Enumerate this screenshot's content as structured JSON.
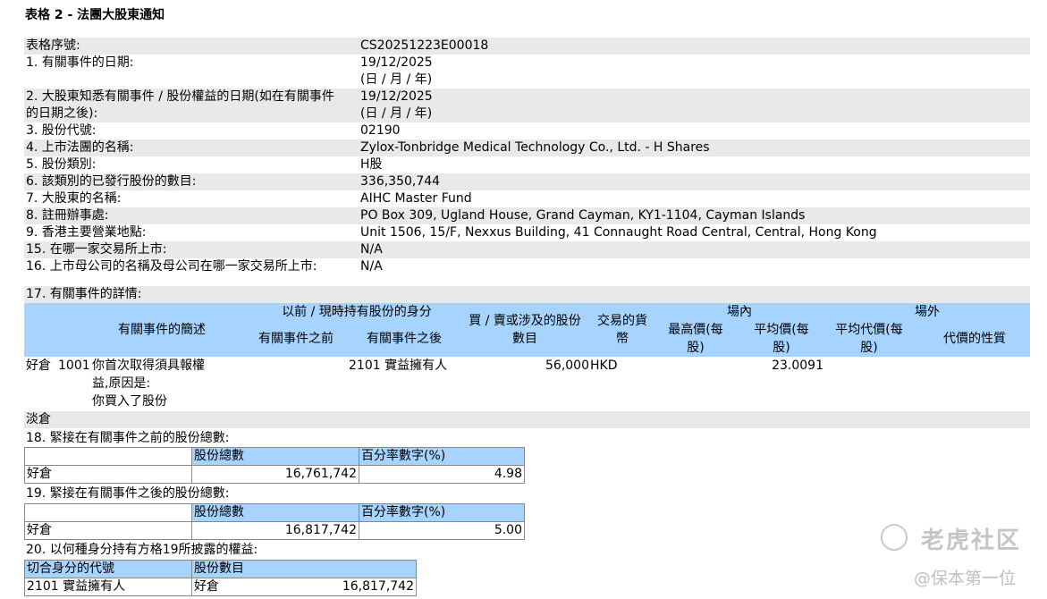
{
  "title": "表格 2 - 法團大股東通知",
  "fields": [
    {
      "label": "表格序號:",
      "value": "CS20251223E00018"
    },
    {
      "label": "1. 有關事件的日期:",
      "value": "19/12/2025",
      "value2": "(日 / 月 / 年)"
    },
    {
      "label": "2. 大股東知悉有關事件 / 股份權益的日期(如在有關事件",
      "label2": "的日期之後):",
      "value": "19/12/2025",
      "value2": "(日 / 月 / 年)"
    },
    {
      "label": "3. 股份代號:",
      "value": "02190"
    },
    {
      "label": "4. 上市法團的名稱:",
      "value": "Zylox-Tonbridge Medical Technology Co., Ltd. - H Shares"
    },
    {
      "label": "5. 股份類別:",
      "value": "H股"
    },
    {
      "label": "6. 該類別的已發行股份的數目:",
      "value": "336,350,744"
    },
    {
      "label": "7. 大股東的名稱:",
      "value": "AIHC Master Fund"
    },
    {
      "label": "8. 註冊辦事處:",
      "value": "PO Box 309, Ugland House, Grand Cayman, KY1-1104, Cayman Islands"
    },
    {
      "label": "9. 香港主要營業地點:",
      "value": "Unit 1506, 15/F, Nexxus Building, 41 Connaught Road Central, Central, Hong Kong"
    },
    {
      "label": "15. 在哪一家交易所上市:",
      "value": "N/A"
    },
    {
      "label": "16. 上市母公司的名稱及母公司在哪一家交易所上市:",
      "value": "N/A"
    }
  ],
  "section17": {
    "label": "17. 有關事件的詳情:",
    "headers": {
      "summary": "有關事件的簡述",
      "capacity": "以前 / 現時持有股份的身分",
      "before": "有關事件之前",
      "after": "有關事件之後",
      "shares": "買 / 賣或涉及的股份",
      "shares2": "數目",
      "currency": "交易的貨",
      "currency2": "幣",
      "onexchange": "場內",
      "high": "最高價(每",
      "high2": "股)",
      "avg": "平均價(每",
      "avg2": "股)",
      "offexchange": "場外",
      "offavg": "平均代價(每",
      "offavg2": "股)",
      "consideration": "代價的性質"
    },
    "row": {
      "position": "好倉",
      "code": "1001",
      "desc1": "你首次取得須具報權",
      "desc2": "益,原因是:",
      "desc3": "你買入了股份",
      "after": "2101 實益擁有人",
      "shares": "56,000",
      "currency": "HKD",
      "avg": "23.0091"
    },
    "short_label": "淡倉"
  },
  "section18": {
    "label": "18. 緊接在有關事件之前的股份總數:",
    "col1": "股份總數",
    "col2": "百分率數字(%)",
    "row_label": "好倉",
    "total": "16,761,742",
    "pct": "4.98"
  },
  "section19": {
    "label": "19. 緊接在有關事件之後的股份總數:",
    "col1": "股份總數",
    "col2": "百分率數字(%)",
    "row_label": "好倉",
    "total": "16,817,742",
    "pct": "5.00"
  },
  "section20": {
    "label": "20. 以何種身分持有方格19所披露的權益:",
    "col1": "切合身分的代號",
    "col2": "股份數目",
    "code": "2101 實益擁有人",
    "position": "好倉",
    "count": "16,817,742"
  },
  "watermark": {
    "line1": "老虎社区",
    "line2": "@保本第一位"
  }
}
